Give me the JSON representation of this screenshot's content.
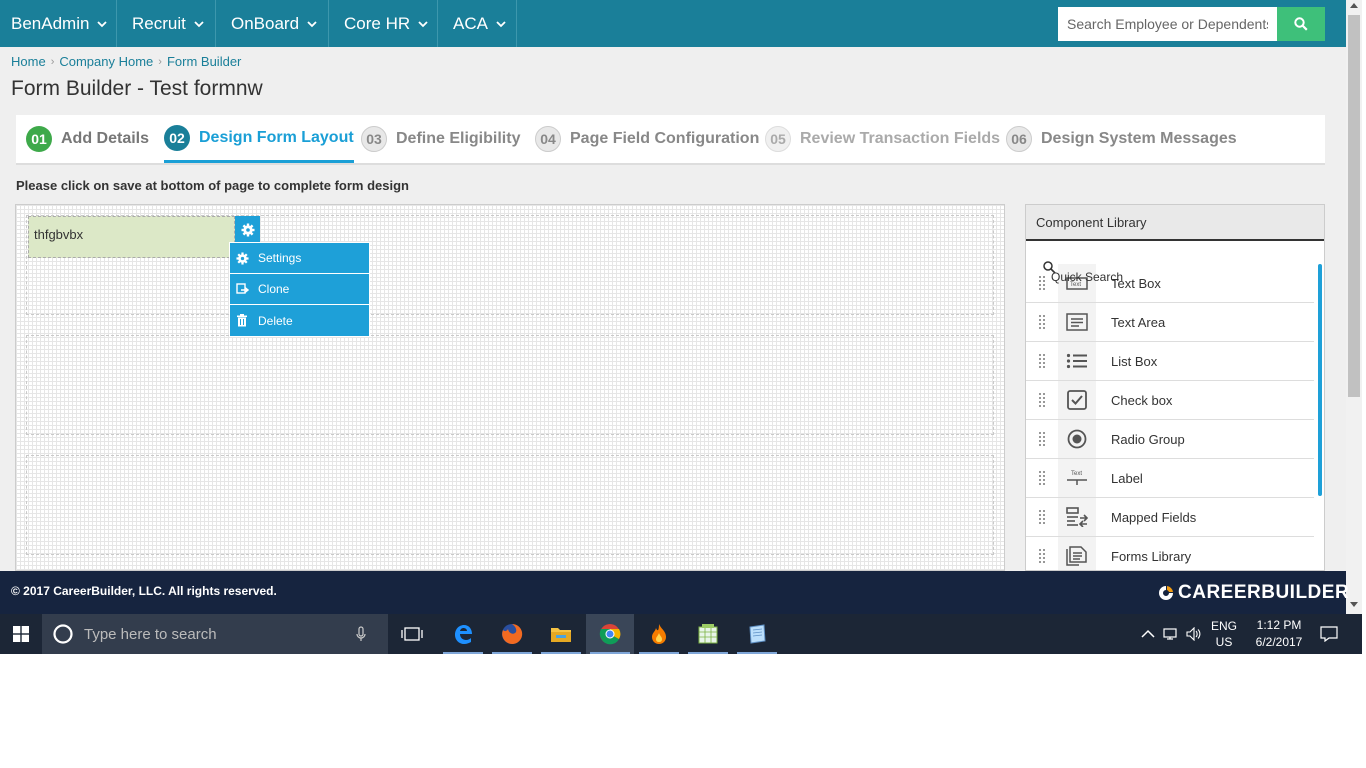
{
  "nav": {
    "items": [
      "BenAdmin",
      "Recruit",
      "OnBoard",
      "Core HR",
      "ACA"
    ],
    "search_placeholder": "Search Employee or Dependents"
  },
  "breadcrumb": [
    "Home",
    "Company Home",
    "Form Builder"
  ],
  "page_title": "Form Builder - Test formnw",
  "steps": [
    {
      "num": "01",
      "label": "Add Details",
      "state": "done"
    },
    {
      "num": "02",
      "label": "Design Form Layout",
      "state": "active"
    },
    {
      "num": "03",
      "label": "Define Eligibility",
      "state": "todo"
    },
    {
      "num": "04",
      "label": "Page Field Configuration",
      "state": "todo"
    },
    {
      "num": "05",
      "label": "Review Transaction Fields",
      "state": "disabled"
    },
    {
      "num": "06",
      "label": "Design System Messages",
      "state": "todo"
    }
  ],
  "notice": "Please click on save at bottom of page to complete form design",
  "canvas": {
    "field_label": "thfgbvbx",
    "context_menu": [
      "Settings",
      "Clone",
      "Delete"
    ]
  },
  "library": {
    "title": "Component Library",
    "quick_search": "Quick Search",
    "items": [
      {
        "label": "Text Box",
        "icon": "textbox-icon"
      },
      {
        "label": "Text Area",
        "icon": "textarea-icon"
      },
      {
        "label": "List Box",
        "icon": "listbox-icon"
      },
      {
        "label": "Check box",
        "icon": "checkbox-icon"
      },
      {
        "label": "Radio Group",
        "icon": "radio-icon"
      },
      {
        "label": "Label",
        "icon": "label-icon"
      },
      {
        "label": "Mapped Fields",
        "icon": "mapped-fields-icon"
      },
      {
        "label": "Forms Library",
        "icon": "forms-library-icon"
      }
    ]
  },
  "footer": {
    "copyright": "© 2017 CareerBuilder, LLC. All rights reserved.",
    "logo": "CAREERBUILDER"
  },
  "taskbar": {
    "search_placeholder": "Type here to search",
    "lang_top": "ENG",
    "lang_bottom": "US",
    "time": "1:12 PM",
    "date": "6/2/2017"
  },
  "colors": {
    "nav_bg": "#1a7f99",
    "accent": "#1ea0d8",
    "search_button": "#3ec07a",
    "done_step": "#3ea94a",
    "footer_bg": "#16243f",
    "taskbar_bg": "#1c2636"
  }
}
